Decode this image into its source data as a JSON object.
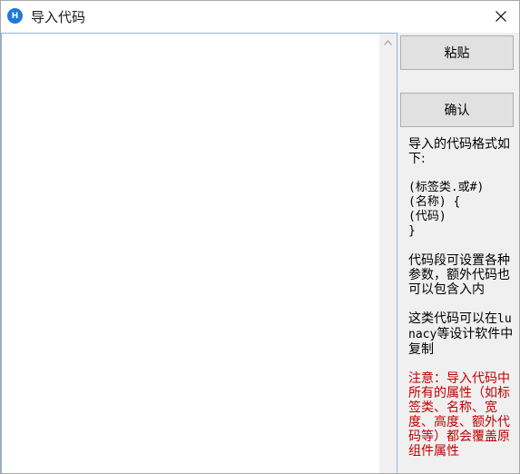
{
  "window": {
    "title": "导入代码",
    "icon_letter": "H",
    "close_icon": "close-icon"
  },
  "editor": {
    "value": "",
    "placeholder": ""
  },
  "buttons": {
    "paste_label": "粘贴",
    "confirm_label": "确认"
  },
  "help": {
    "format_intro": "导入的代码格式如下:",
    "format_code": "(标签类.或#)\n(名称) {\n(代码)\n}",
    "params_note": "代码段可设置各种参数，额外代码也可以包含入内",
    "copy_note_pre": "这类代码可以在",
    "copy_note_app": "lunacy",
    "copy_note_post": "等设计软件中复制",
    "warning": "注意：导入代码中所有的属性（如标签类、名称、宽度、高度、额外代码等）都会覆盖原组件属性"
  },
  "colors": {
    "accent": "#1e7bd8",
    "warning": "#c00000",
    "side_bg": "#f0f0f0",
    "editor_border": "#8fb6e0"
  }
}
